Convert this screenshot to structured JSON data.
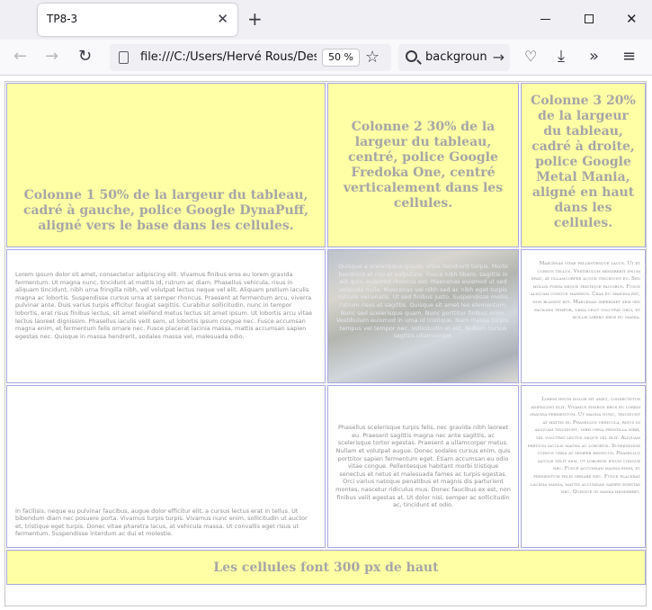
{
  "browser": {
    "tab_title": "TP8-3",
    "tab_close": "✕",
    "new_tab": "+",
    "window_close": "✕",
    "url": "file:///C:/Users/Hervé Rous/Desk",
    "zoom": "50 %",
    "search_text": "backgroun",
    "icons": [
      "back-icon",
      "forward-icon",
      "reload-icon",
      "star-icon",
      "search-icon",
      "pocket-icon",
      "download-icon",
      "more-tools-icon",
      "menu-icon"
    ]
  },
  "table": {
    "headers": [
      "Colonne 1 50% de la largeur du tableau, cadré à gauche, police Google DynaPuff, aligné vers le base dans les cellules.",
      "Colonne 2 30% de la largeur du tableau, centré, police Google Fredoka One, centré verticalement dans les cellules.",
      "Colonne 3 20% de la largeur du tableau, cadré à droite, police Google Metal Mania, aligné en haut dans les cellules."
    ],
    "rows": [
      [
        "Lorem ipsum dolor sit amet, consectetur adipiscing elit. Vivamus finibus eros eu lorem gravida fermentum. Ut magna nunc, tincidunt at mattis id, rutrum ac diam. Phasellus vehicula, risus in aliquam tincidunt, nibh urna fringilla nibh, vel volutpat lectus neque vel elit. Aliquam pretium iaculis magna ac lobortis. Suspendisse cursus urna at semper rhoncus. Praesent at fermentum arcu, viverra pulvinar ante. Duis varius turpis efficitur feugiat sagittis. Curabitur sollicitudin, nunc in tempor lobortis, erat risus finibus lectus, sit amet eleifend metus lectus sit amet ipsum. Ut lobortis arcu vitae lectus laoreet dignissim. Phasellus iaculis velit sem, ut lobortis ipsum congue nec. Fusce accumsan magna enim, et fermentum felis ornare nec. Fusce placerat lacinia massa, mattis accumsan sapien egestas nec. Quisque in massa hendrerit, sodales massa vel, malesuada odio.",
        "Quisque a scelerisque ipsum, vitae hendrerit turpis. Morbi hendrerit et nisi et vulputate. Fusce nibh libero, sagittis in elit quis, euismod rhoncus est. Maecenas euismod ut sed vehicula nulla. Maecenas vel nibh sed ac nibh eget turpis rutrum venenatis. Ut sed finibus justo. Suspendisse mollis rutrum risus et sagittis. Quisque sit amet leo elementum. Nunc sed scelerisque quam. Nunc porttitor finibus enim. Vestibulum euismod in urna id tristique. Nam massa turpis, tempus vel tempor nec, sollicitudin et elit. Nullam cursus sagittis ullamcorper.",
        "Maecenas vitae pellentesque lacus. Ut et cursus tellus. Vestibulum hendrerit ipsum erat, at ullamcorper augue tincidunt eu. Sed mollis porta neque tristique faucibus. Fusce aliquam congue maximus. Cras eu gravida est, non blandit est. Maecenas imperdiet sem sed facilisis tempor, urna velit volutpat orci, et mollis libero eros eu massa."
      ],
      [
        "In facilisis, neque eu pulvinar faucibus, augue dolor efficitur elit, a cursus lectus erat in tellus. Ut bibendum diam nec posuere porta. Vivamus turpis turpis. Vivamus nunc enim, sollicitudin ut auctor et, tristique eget turpis. Donec vitae pharetra lacus, at vehicula massa. Ut convallis eget risus ut fermentum. Suspendisse interdum ac dui et molestie.",
        "Phasellus scelerisque turpis felis, nec gravida nibh laoreet eu. Praesent sagittis magna nec ante sagittis, ac scelerisque tortor egestas. Praesent a ullamcorper metus. Nullam et volutpat augue. Donec sodales cursus enim, quis porttitor sapien fermentum eget. Etiam accumsan eu odio vitae congue. Pellentesque habitant morbi tristique senectus et netus et malesuada fames ac turpis egestas. Orci varius natoque penatibus et magnis dis parturient montes, nascetur ridiculus mus. Donec faucibus ex est, non finibus velit egestas at. Ut dolor nisi, semper ac sollicitudin ac, tincidunt et odio.",
        "Lorem ipsum dolor sit amet, consectetur adipiscing elit. Vivamus finibus eros eu lorem gravida fermentum. Ut magna nunc, tincidunt at mattis id. Phasellus vehicula, risus in aliquam tincidunt, nibh urna fringilla nibh, vel volutpat lectus neque vel elit. Aliquam pretium iaculis magna ac lobortis. Suspendisse cursus urna at semper rhoncus. Phasellus iaculis velit sem, ut lobortis ipsum congue nec. Fusce accumsan magna enim, et fermentum felis ornare nec. Fusce placerat lacinia massa, mattis accumsan sapien egestas nec. Quisque in massa hendrerit."
      ]
    ],
    "footer": "Les cellules font 300 px de haut"
  },
  "colors": {
    "header_background": "#ffffa6",
    "header_text": "#a6a6a6",
    "cell_border": "#a8a8e0"
  }
}
